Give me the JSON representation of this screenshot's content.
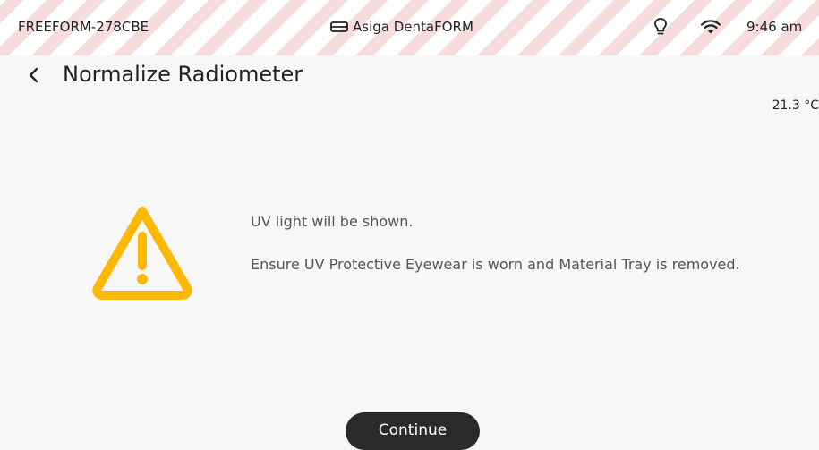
{
  "status_bar": {
    "device_name": "FREEFORM-278CBE",
    "printer_name": "Asiga DentaFORM",
    "printer_icon": "printer-icon",
    "bulb_icon": "lightbulb-icon",
    "wifi_icon": "wifi-icon",
    "time": "9:46 am"
  },
  "header": {
    "back_icon": "chevron-left-icon",
    "title": "Normalize Radiometer"
  },
  "temperature": "21.3 °C",
  "warning": {
    "icon": "warning-triangle-icon",
    "icon_color": "#FFB800",
    "line1": "UV light will be shown.",
    "line2": "Ensure UV Protective Eyewear is worn and Material Tray is removed."
  },
  "actions": {
    "continue_label": "Continue"
  },
  "colors": {
    "stripe": "#f7dcdc",
    "button_bg": "#2a2a2a",
    "background": "#f7f7f7"
  }
}
